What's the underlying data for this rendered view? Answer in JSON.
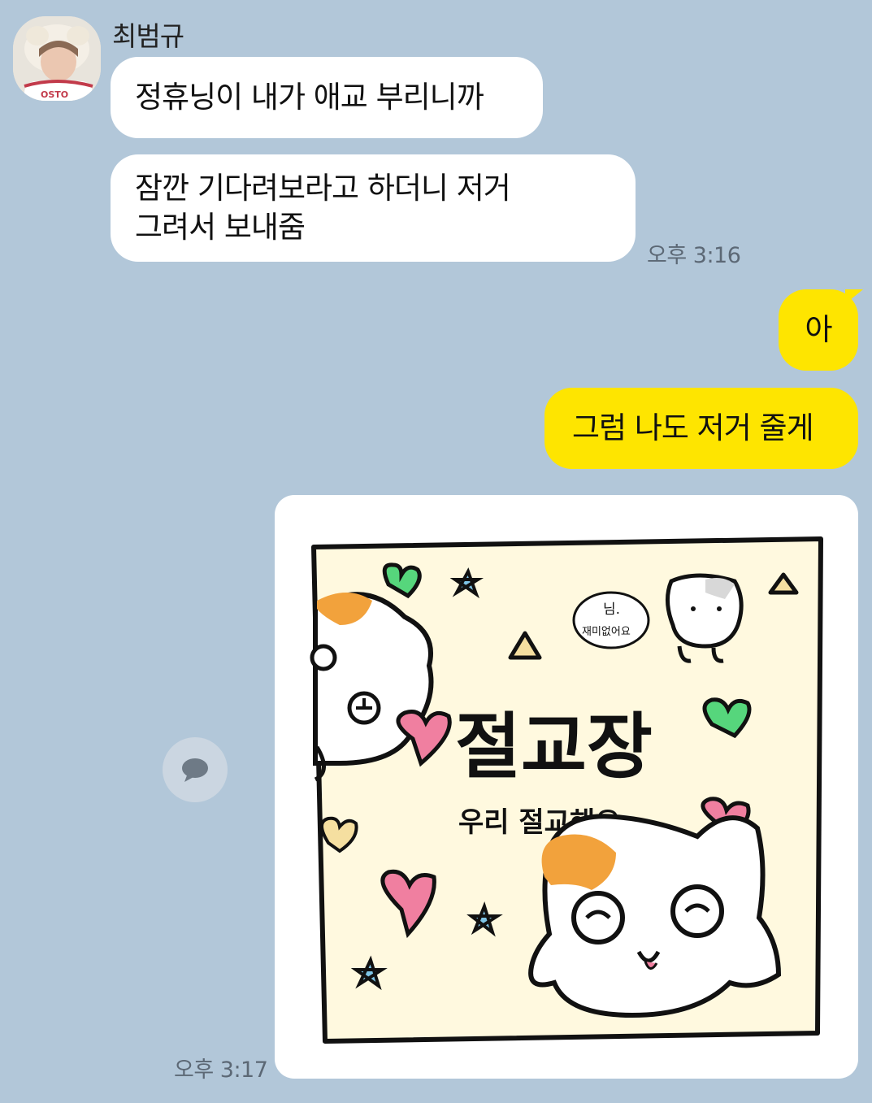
{
  "sender": {
    "name": "최범규"
  },
  "messages": [
    {
      "text": "정휴닝이 내가 애교 부리니까"
    },
    {
      "lines": [
        "잠깐 기다려보라고 하더니 저거",
        "그려서 보내줌"
      ],
      "time": "오후 3:16"
    },
    {
      "text": "아"
    },
    {
      "text": "그럼 나도 저거 줄게"
    }
  ],
  "image_message": {
    "title": "절교장",
    "subtitle": "우리 절교해요",
    "speech": [
      "님.",
      "재미없어요"
    ],
    "time": "오후 3:17"
  },
  "icons": {
    "share": "speech-bubble-icon"
  },
  "colors": {
    "background": "#B2C7D9",
    "incoming_bubble": "#FFFFFF",
    "outgoing_bubble": "#FEE500",
    "drawing_paper": "#FFF9DF",
    "hamster_orange": "#F2A23C",
    "heart_pink": "#F07FA0",
    "heart_green": "#56D67C",
    "star_blue": "#7EC4E6"
  }
}
